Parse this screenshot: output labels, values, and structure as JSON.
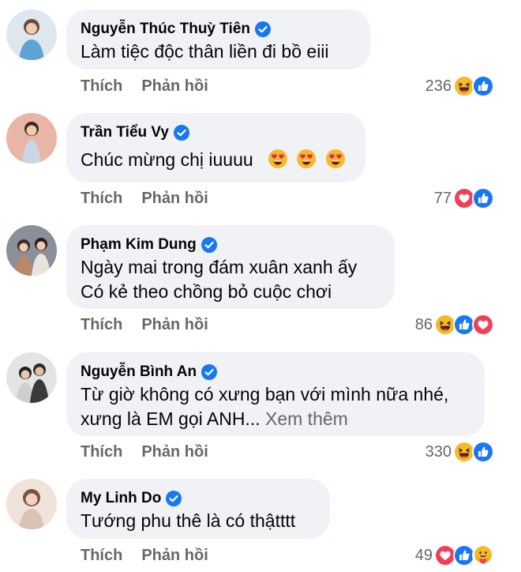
{
  "comments": [
    {
      "author": "Nguyễn Thúc Thuỳ Tiên",
      "lines": [
        "Làm tiệc độc thân liền đi bồ eiii"
      ],
      "like_label": "Thích",
      "reply_label": "Phản hồi",
      "reaction_count": "236",
      "reactions": [
        "haha-reaction-icon",
        "like-reaction-icon"
      ]
    },
    {
      "author": "Trần Tiểu Vy",
      "lines": [
        "Chúc mừng chị iuuuu"
      ],
      "emojis": [
        "heart-eyes-emoji",
        "heart-eyes-emoji",
        "heart-eyes-emoji"
      ],
      "like_label": "Thích",
      "reply_label": "Phản hồi",
      "reaction_count": "77",
      "reactions": [
        "love-reaction-icon",
        "like-reaction-icon"
      ]
    },
    {
      "author": "Phạm Kim Dung",
      "lines": [
        "Ngày mai trong đám xuân xanh ấy",
        "Có kẻ theo chồng bỏ cuộc chơi"
      ],
      "like_label": "Thích",
      "reply_label": "Phản hồi",
      "reaction_count": "86",
      "reactions": [
        "haha-reaction-icon",
        "like-reaction-icon",
        "love-reaction-icon"
      ]
    },
    {
      "author": "Nguyễn Bình An",
      "lines": [
        "Từ giờ không có xưng bạn với mình nữa nhé,",
        "xưng là EM gọi ANH..."
      ],
      "see_more": "Xem thêm",
      "like_label": "Thích",
      "reply_label": "Phản hồi",
      "reaction_count": "330",
      "reactions": [
        "haha-reaction-icon",
        "like-reaction-icon"
      ]
    },
    {
      "author": "My Linh Do",
      "lines": [
        "Tướng phu thê là có thậtttt"
      ],
      "like_label": "Thích",
      "reply_label": "Phản hồi",
      "reaction_count": "49",
      "reactions": [
        "love-reaction-icon",
        "like-reaction-icon",
        "care-reaction-icon"
      ]
    }
  ],
  "colors": {
    "bubble": "#f0f2f5",
    "secondary_text": "#65676b",
    "like_blue": "#1877f2",
    "love_red": "#f33e58",
    "haha_yellow": "#f7b928"
  }
}
